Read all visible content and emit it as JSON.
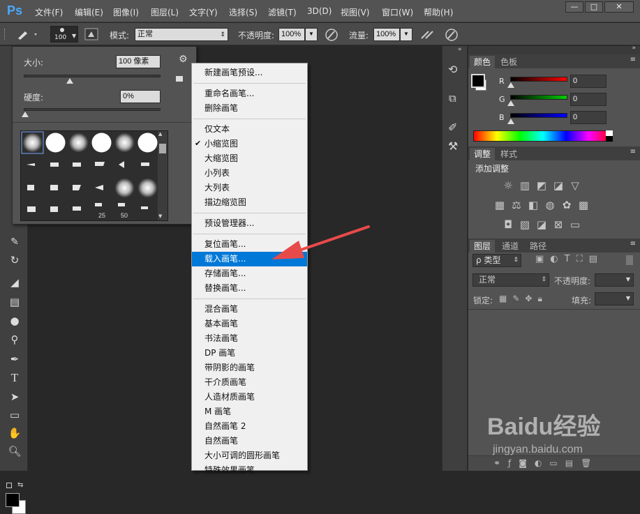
{
  "app": {
    "logo": "Ps"
  },
  "menubar": {
    "items": [
      "文件(F)",
      "编辑(E)",
      "图像(I)",
      "图层(L)",
      "文字(Y)",
      "选择(S)",
      "滤镜(T)",
      "3D(D)",
      "视图(V)",
      "窗口(W)",
      "帮助(H)"
    ],
    "window_buttons": [
      "—",
      "□",
      "✕"
    ]
  },
  "options": {
    "brush_size": "100",
    "mode_label": "模式:",
    "mode_value": "正常",
    "opacity_label": "不透明度:",
    "opacity_value": "100%",
    "flow_label": "流量:",
    "flow_value": "100%"
  },
  "brush_panel": {
    "size_label": "大小:",
    "size_value": "100 像素",
    "hardness_label": "硬度:",
    "hardness_value": "0%",
    "size_fraction": 0.33,
    "hardness_fraction": 0.0,
    "thumb_labels": [
      "25",
      "50"
    ]
  },
  "context_menu": {
    "groups": [
      [
        "新建画笔预设..."
      ],
      [
        "重命名画笔...",
        "删除画笔"
      ],
      [
        "仅文本",
        "小缩览图",
        "大缩览图",
        "小列表",
        "大列表",
        "描边缩览图"
      ],
      [
        "预设管理器..."
      ],
      [
        "复位画笔...",
        "载入画笔...",
        "存储画笔...",
        "替换画笔..."
      ],
      [
        "混合画笔",
        "基本画笔",
        "书法画笔",
        "DP 画笔",
        "带阴影的画笔",
        "干介质画笔",
        "人造材质画笔",
        "M 画笔",
        "自然画笔 2",
        "自然画笔",
        "大小可调的圆形画笔",
        "特殊效果画笔"
      ]
    ],
    "checked_item": "小缩览图",
    "highlighted_item": "载入画笔..."
  },
  "color_panel": {
    "tabs": [
      "颜色",
      "色板"
    ],
    "channels": [
      {
        "name": "R",
        "value": "0",
        "color": "#ff0000"
      },
      {
        "name": "G",
        "value": "0",
        "color": "#00cc00"
      },
      {
        "name": "B",
        "value": "0",
        "color": "#0000ff"
      }
    ]
  },
  "adjust_panel": {
    "tabs": [
      "调整",
      "样式"
    ],
    "title": "添加调整"
  },
  "layers_panel": {
    "tabs": [
      "图层",
      "通道",
      "路径"
    ],
    "filter_label": "ρ 类型",
    "blend_value": "正常",
    "opacity_label": "不透明度:",
    "lock_label": "锁定:",
    "fill_label": "填充:"
  },
  "watermark": {
    "brand": "Baidu经验",
    "url": "jingyan.baidu.com"
  },
  "colors": {
    "highlight": "#0078d7",
    "arrow": "#e84a4a",
    "ps_blue": "#4aa9ff"
  }
}
